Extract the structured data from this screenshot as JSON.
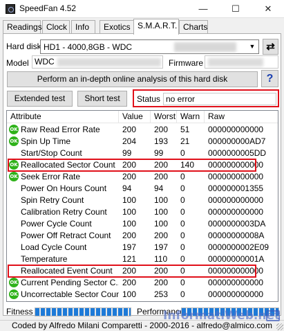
{
  "window": {
    "title": "SpeedFan 4.52",
    "min": "—",
    "max": "☐",
    "close": "✕"
  },
  "tabs": [
    {
      "label": "Readings"
    },
    {
      "label": "Clock"
    },
    {
      "label": "Info"
    },
    {
      "label": "Exotics"
    },
    {
      "label": "S.M.A.R.T."
    },
    {
      "label": "Charts"
    }
  ],
  "active_tab": "S.M.A.R.T.",
  "smart": {
    "hard_disk_label": "Hard disk",
    "hard_disk_value": "HD1 - 4000,8GB - WDC",
    "model_label": "Model",
    "model_value": "WDC",
    "firmware_label": "Firmware",
    "analysis_button": "Perform an in-depth online analysis of this hard disk",
    "help_button": "?",
    "extended_test_button": "Extended test",
    "short_test_button": "Short test",
    "status_label": "Status",
    "status_value": "no error"
  },
  "table": {
    "columns": [
      "Attribute",
      "Value",
      "Worst",
      "Warn",
      "Raw"
    ],
    "rows": [
      {
        "ok": true,
        "attribute": "Raw Read Error Rate",
        "value": "200",
        "worst": "200",
        "warn": "51",
        "raw": "000000000000"
      },
      {
        "ok": true,
        "attribute": "Spin Up Time",
        "value": "204",
        "worst": "193",
        "warn": "21",
        "raw": "000000000AD7"
      },
      {
        "ok": false,
        "attribute": "Start/Stop Count",
        "value": "99",
        "worst": "99",
        "warn": "0",
        "raw": "0000000005DD"
      },
      {
        "ok": true,
        "attribute": "Reallocated Sector Count",
        "value": "200",
        "worst": "200",
        "warn": "140",
        "raw": "000000000000"
      },
      {
        "ok": true,
        "attribute": "Seek Error Rate",
        "value": "200",
        "worst": "200",
        "warn": "0",
        "raw": "000000000000"
      },
      {
        "ok": false,
        "attribute": "Power On Hours Count",
        "value": "94",
        "worst": "94",
        "warn": "0",
        "raw": "000000001355"
      },
      {
        "ok": false,
        "attribute": "Spin Retry Count",
        "value": "100",
        "worst": "100",
        "warn": "0",
        "raw": "000000000000"
      },
      {
        "ok": false,
        "attribute": "Calibration Retry Count",
        "value": "100",
        "worst": "100",
        "warn": "0",
        "raw": "000000000000"
      },
      {
        "ok": false,
        "attribute": "Power Cycle Count",
        "value": "100",
        "worst": "100",
        "warn": "0",
        "raw": "0000000003DA"
      },
      {
        "ok": false,
        "attribute": "Power Off Retract Count",
        "value": "200",
        "worst": "200",
        "warn": "0",
        "raw": "00000000008A"
      },
      {
        "ok": false,
        "attribute": "Load Cycle Count",
        "value": "197",
        "worst": "197",
        "warn": "0",
        "raw": "0000000002E09"
      },
      {
        "ok": false,
        "attribute": "Temperature",
        "value": "121",
        "worst": "110",
        "warn": "0",
        "raw": "00000000001A"
      },
      {
        "ok": false,
        "attribute": "Reallocated Event Count",
        "value": "200",
        "worst": "200",
        "warn": "0",
        "raw": "000000000000"
      },
      {
        "ok": true,
        "attribute": "Current Pending Sector C...",
        "value": "200",
        "worst": "200",
        "warn": "0",
        "raw": "000000000000"
      },
      {
        "ok": true,
        "attribute": "Uncorrectable Sector Count",
        "value": "100",
        "worst": "253",
        "warn": "0",
        "raw": "000000000000"
      }
    ],
    "highlighted_rows": [
      "Reallocated Sector Count",
      "Reallocated Event Count"
    ]
  },
  "meters": {
    "fitness_label": "Fitness",
    "performance_label": "Performance",
    "fitness_level": 1.0,
    "performance_level": 1.0
  },
  "footer": {
    "text": "Coded by Alfredo Milani Comparetti - 2000-2016 - alfredo@almico.com"
  },
  "watermark": {
    "text": "InformatiWeb.net"
  },
  "colors": {
    "highlight": "#e0101a",
    "ok_icon": "#2fb21a",
    "meter": "#1d7ad8"
  },
  "icons": {
    "ok": "ok-status-icon",
    "refresh": "refresh-icon",
    "app": "speedfan-app-icon"
  }
}
